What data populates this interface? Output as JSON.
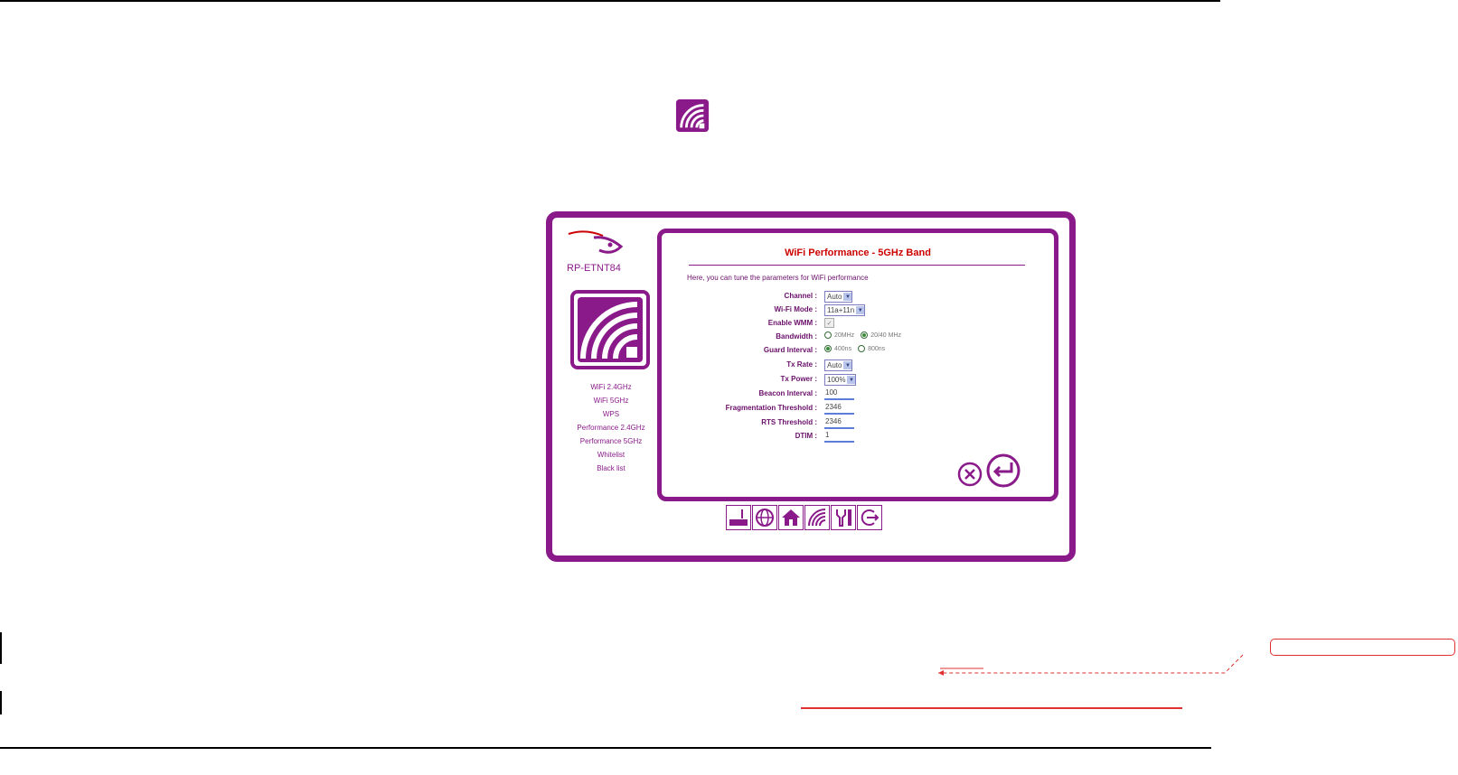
{
  "device": {
    "model": "RP-ETNT84"
  },
  "side_nav": [
    "WiFi 2.4GHz",
    "WiFi 5GHz",
    "WPS",
    "Performance 2.4GHz",
    "Performance 5GHz",
    "Whitelist",
    "Black list"
  ],
  "panel": {
    "title": "WiFi Performance - 5GHz Band",
    "intro": "Here, you can tune the parameters for WiFi performance"
  },
  "form": {
    "channel": {
      "label": "Channel :",
      "value": "Auto"
    },
    "wifi_mode": {
      "label": "Wi-Fi Mode :",
      "value": "11a+11n"
    },
    "wmm": {
      "label": "Enable WMM :",
      "checked": true
    },
    "bandwidth": {
      "label": "Bandwidth :",
      "options": [
        "20MHz",
        "20/40 MHz"
      ],
      "selected": 1
    },
    "guard_interval": {
      "label": "Guard Interval :",
      "options": [
        "400ns",
        "800ns"
      ],
      "selected": 0
    },
    "tx_rate": {
      "label": "Tx Rate :",
      "value": "Auto"
    },
    "tx_power": {
      "label": "Tx Power :",
      "value": "100%"
    },
    "beacon_interval": {
      "label": "Beacon Interval :",
      "value": "100"
    },
    "frag_threshold": {
      "label": "Fragmentation Threshold :",
      "value": "2346"
    },
    "rts_threshold": {
      "label": "RTS Threshold :",
      "value": "2346"
    },
    "dtim": {
      "label": "DTIM :",
      "value": "1"
    }
  },
  "colors": {
    "brand": "#8a1a8a",
    "title": "#cc0000",
    "annotation": "#e03030"
  },
  "icons": {
    "top": "wifi-icon",
    "bottom_bar": [
      "status-icon",
      "globe-icon",
      "home-icon",
      "wifi-icon",
      "tools-icon",
      "logout-icon"
    ]
  }
}
